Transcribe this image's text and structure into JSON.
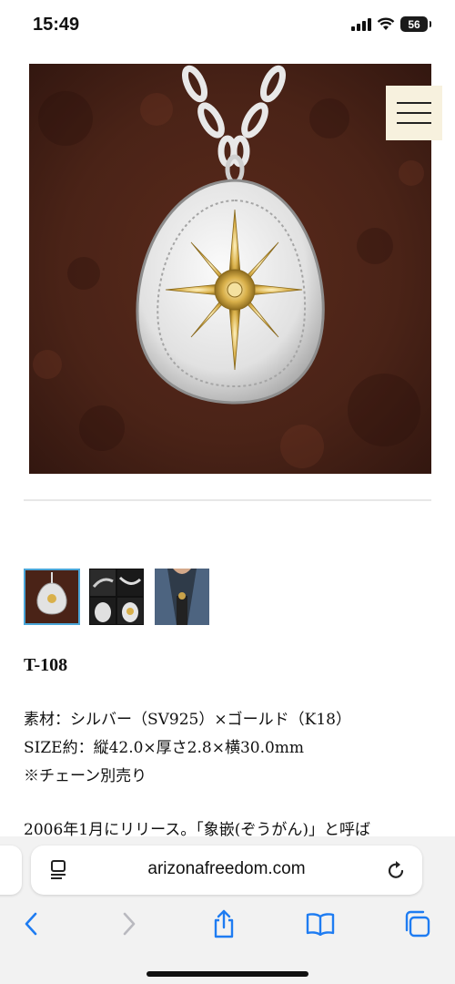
{
  "status_bar": {
    "time": "15:49",
    "battery": "56"
  },
  "browser": {
    "url": "arizonafreedom.com"
  },
  "product": {
    "sku": "T-108",
    "material": "素材：シルバー（SV925）×ゴールド（K18）",
    "size": "SIZE約：縦42.0×厚さ2.8×横30.0mm",
    "chain_note": "※チェーン別売り",
    "intro": "2006年1月にリリース。「象嵌(ぞうがん)」と呼ば"
  },
  "icons": {
    "menu": "hamburger-menu-icon",
    "back": "chevron-left-icon",
    "forward": "chevron-right-icon",
    "share": "share-icon",
    "bookmarks": "book-icon",
    "tabs": "tabs-icon",
    "reload": "reload-icon"
  },
  "colors": {
    "accent": "#1e7cf2",
    "menu_bg": "#f7f1de",
    "thumb_active": "#4aa6d8"
  }
}
